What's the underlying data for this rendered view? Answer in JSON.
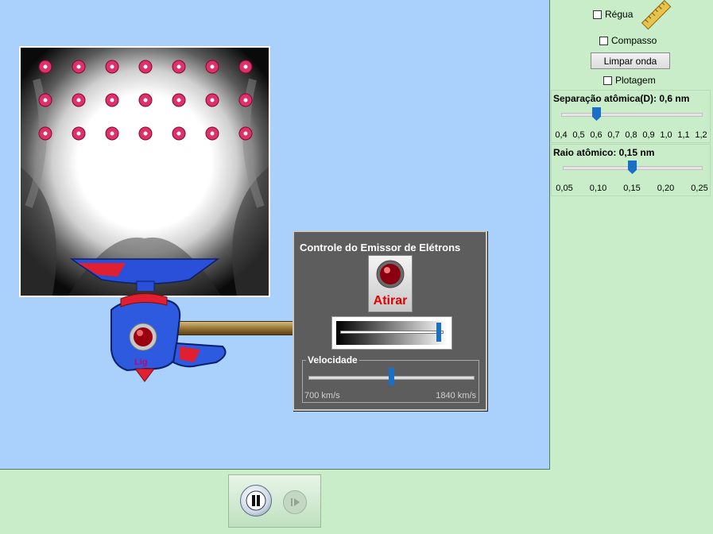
{
  "panel": {
    "ruler_label": "Régua",
    "compass_label": "Compasso",
    "clear_wave_label": "Limpar onda",
    "plot_label": "Plotagem",
    "separation": {
      "title": "Separação atômica(D): 0,6 nm",
      "ticks": [
        "0,4",
        "0,5",
        "0,6",
        "0,7",
        "0,8",
        "0,9",
        "1,0",
        "1,1",
        "1,2"
      ],
      "value_fraction": 0.25
    },
    "radius": {
      "title": "Raio atômico: 0,15 nm",
      "ticks": [
        "0,05",
        "0,10",
        "0,15",
        "0,20",
        "0,25"
      ],
      "value_fraction": 0.5
    }
  },
  "gun": {
    "power_label": "Lig"
  },
  "control": {
    "title": "Controle do Emissor de Elétrons",
    "fire_label": "Atirar",
    "intensity_fraction": 0.97,
    "velocity": {
      "title": "Velocidade",
      "min_label": "700 km/s",
      "max_label": "1840 km/s",
      "value_fraction": 0.5
    }
  },
  "colors": {
    "sim_background": "#a9d1fc",
    "panel_background": "#c8edc8",
    "control_background": "#5d5d5d",
    "fire_red": "#e00000",
    "slider_thumb": "#1a6fc6",
    "atom_pink": "#e0306a"
  },
  "icons": [
    "ruler-icon",
    "fire-light-icon",
    "pause-icon",
    "step-icon",
    "power-light-icon"
  ]
}
